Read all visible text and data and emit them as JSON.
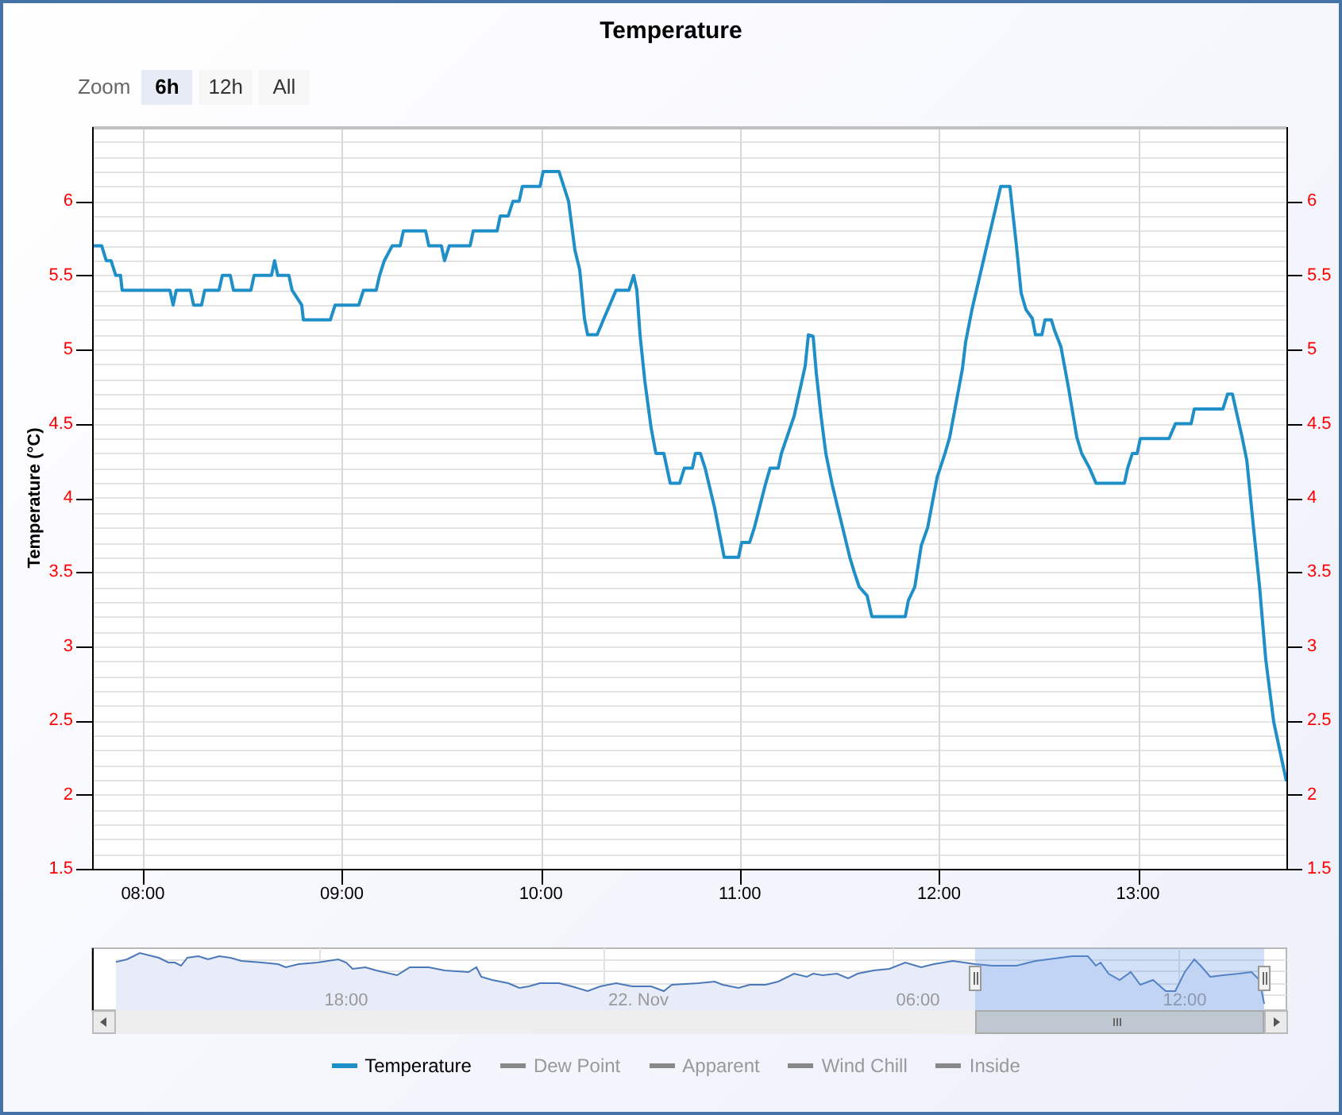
{
  "title": "Temperature",
  "zoom": {
    "label": "Zoom",
    "buttons": [
      {
        "label": "6h",
        "selected": true
      },
      {
        "label": "12h",
        "selected": false
      },
      {
        "label": "All",
        "selected": false
      }
    ]
  },
  "chart_data": {
    "type": "line",
    "ylabel": "Temperature (°C)",
    "grid": true,
    "xlim": [
      7.745,
      13.746
    ],
    "ylim": [
      1.5,
      6.5
    ],
    "xticks": [
      {
        "value": 8,
        "label": "08:00"
      },
      {
        "value": 9,
        "label": "09:00"
      },
      {
        "value": 10,
        "label": "10:00"
      },
      {
        "value": 11,
        "label": "11:00"
      },
      {
        "value": 12,
        "label": "12:00"
      },
      {
        "value": 13,
        "label": "13:00"
      }
    ],
    "yticks": [
      {
        "value": 1.5,
        "label": "1.5"
      },
      {
        "value": 2,
        "label": "2"
      },
      {
        "value": 2.5,
        "label": "2.5"
      },
      {
        "value": 3,
        "label": "3"
      },
      {
        "value": 3.5,
        "label": "3.5"
      },
      {
        "value": 4,
        "label": "4"
      },
      {
        "value": 4.5,
        "label": "4.5"
      },
      {
        "value": 5,
        "label": "5"
      },
      {
        "value": 5.5,
        "label": "5.5"
      },
      {
        "value": 6,
        "label": "6"
      }
    ],
    "x": [
      7.745,
      7.793,
      7.816,
      7.84,
      7.864,
      7.888,
      7.896,
      8.136,
      8.152,
      8.168,
      8.239,
      8.255,
      8.295,
      8.311,
      8.383,
      8.399,
      8.439,
      8.455,
      8.543,
      8.559,
      8.646,
      8.662,
      8.678,
      8.734,
      8.75,
      8.798,
      8.806,
      8.942,
      8.966,
      9.085,
      9.109,
      9.173,
      9.189,
      9.213,
      9.253,
      9.293,
      9.309,
      9.421,
      9.437,
      9.5,
      9.516,
      9.54,
      9.644,
      9.66,
      9.78,
      9.796,
      9.836,
      9.86,
      9.891,
      9.907,
      9.995,
      10.011,
      10.091,
      10.115,
      10.139,
      10.171,
      10.195,
      10.219,
      10.235,
      10.283,
      10.314,
      10.346,
      10.378,
      10.442,
      10.466,
      10.482,
      10.498,
      10.522,
      10.554,
      10.578,
      10.618,
      10.65,
      10.698,
      10.721,
      10.761,
      10.777,
      10.801,
      10.825,
      10.873,
      10.921,
      10.993,
      11.009,
      11.049,
      11.073,
      11.128,
      11.152,
      11.192,
      11.208,
      11.272,
      11.328,
      11.344,
      11.368,
      11.384,
      11.408,
      11.432,
      11.464,
      11.512,
      11.552,
      11.575,
      11.599,
      11.639,
      11.663,
      11.831,
      11.847,
      11.879,
      11.911,
      11.943,
      11.991,
      12.03,
      12.054,
      12.118,
      12.134,
      12.166,
      12.31,
      12.357,
      12.389,
      12.413,
      12.437,
      12.469,
      12.485,
      12.517,
      12.533,
      12.565,
      12.581,
      12.613,
      12.653,
      12.693,
      12.717,
      12.757,
      12.789,
      12.932,
      12.948,
      12.972,
      12.996,
      13.012,
      13.156,
      13.188,
      13.267,
      13.283,
      13.427,
      13.451,
      13.475,
      13.523,
      13.547,
      13.579,
      13.611,
      13.642,
      13.682,
      13.746
    ],
    "series": [
      {
        "name": "Temperature",
        "color": "#1f8fc8",
        "values": [
          5.7,
          5.7,
          5.6,
          5.6,
          5.5,
          5.5,
          5.4,
          5.4,
          5.3,
          5.4,
          5.4,
          5.3,
          5.3,
          5.4,
          5.4,
          5.5,
          5.5,
          5.4,
          5.4,
          5.5,
          5.5,
          5.6,
          5.5,
          5.5,
          5.4,
          5.3,
          5.2,
          5.2,
          5.3,
          5.3,
          5.4,
          5.4,
          5.5,
          5.6,
          5.7,
          5.7,
          5.8,
          5.8,
          5.7,
          5.7,
          5.6,
          5.7,
          5.7,
          5.8,
          5.8,
          5.9,
          5.9,
          6.0,
          6.0,
          6.1,
          6.1,
          6.2,
          6.2,
          6.1,
          6.0,
          5.67,
          5.54,
          5.21,
          5.1,
          5.1,
          5.2,
          5.3,
          5.4,
          5.4,
          5.5,
          5.4,
          5.1,
          4.79,
          4.47,
          4.3,
          4.3,
          4.1,
          4.1,
          4.2,
          4.2,
          4.3,
          4.3,
          4.2,
          3.93,
          3.6,
          3.6,
          3.7,
          3.7,
          3.8,
          4.09,
          4.2,
          4.2,
          4.3,
          4.55,
          4.89,
          5.1,
          5.09,
          4.84,
          4.55,
          4.3,
          4.09,
          3.82,
          3.6,
          3.5,
          3.4,
          3.34,
          3.2,
          3.2,
          3.31,
          3.4,
          3.68,
          3.8,
          4.14,
          4.3,
          4.41,
          4.87,
          5.05,
          5.27,
          6.1,
          6.1,
          5.7,
          5.38,
          5.27,
          5.21,
          5.1,
          5.1,
          5.2,
          5.2,
          5.13,
          5.02,
          4.73,
          4.41,
          4.3,
          4.2,
          4.1,
          4.1,
          4.2,
          4.3,
          4.3,
          4.4,
          4.4,
          4.5,
          4.5,
          4.6,
          4.6,
          4.7,
          4.7,
          4.41,
          4.25,
          3.82,
          3.4,
          2.91,
          2.49,
          2.09
        ]
      }
    ]
  },
  "right_axis": {
    "labels": [
      "6",
      "5.5",
      "5",
      "4.5",
      "4",
      "3.5",
      "3",
      "2.5",
      "2",
      "1.5"
    ]
  },
  "navigator": {
    "labels": [
      "18:00",
      "22. Nov",
      "06:00",
      "12:00"
    ]
  },
  "legend": [
    {
      "kind": "series",
      "visible": true
    },
    {
      "label": "Dew Point",
      "visible": false
    },
    {
      "label": "Apparent",
      "visible": false
    },
    {
      "label": "Wind Chill",
      "visible": false
    },
    {
      "label": "Inside",
      "visible": false
    }
  ]
}
